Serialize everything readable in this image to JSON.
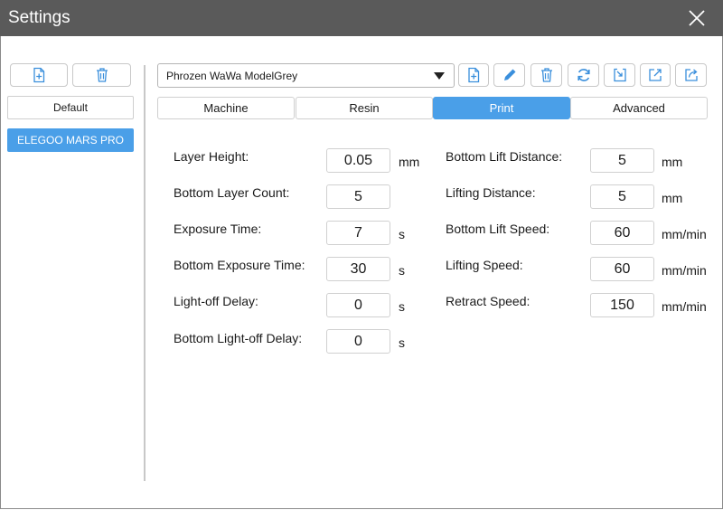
{
  "window": {
    "title": "Settings"
  },
  "sidebar": {
    "items": [
      {
        "label": "Default"
      },
      {
        "label": "ELEGOO MARS PRO"
      }
    ]
  },
  "profile": {
    "selected": "Phrozen WaWa ModelGrey"
  },
  "tabs": [
    {
      "label": "Machine"
    },
    {
      "label": "Resin"
    },
    {
      "label": "Print",
      "active": true
    },
    {
      "label": "Advanced"
    }
  ],
  "left_fields": [
    {
      "label": "Layer Height:",
      "value": "0.05",
      "unit": "mm"
    },
    {
      "label": "Bottom Layer Count:",
      "value": "5",
      "unit": ""
    },
    {
      "label": "Exposure Time:",
      "value": "7",
      "unit": "s"
    },
    {
      "label": "Bottom Exposure Time:",
      "value": "30",
      "unit": "s"
    },
    {
      "label": "Light-off Delay:",
      "value": "0",
      "unit": "s"
    },
    {
      "label": "Bottom Light-off Delay:",
      "value": "0",
      "unit": "s"
    }
  ],
  "right_fields": [
    {
      "label": "Bottom Lift Distance:",
      "value": "5",
      "unit": "mm"
    },
    {
      "label": "Lifting Distance:",
      "value": "5",
      "unit": "mm"
    },
    {
      "label": "Bottom Lift Speed:",
      "value": "60",
      "unit": "mm/min"
    },
    {
      "label": "Lifting Speed:",
      "value": "60",
      "unit": "mm/min"
    },
    {
      "label": "Retract Speed:",
      "value": "150",
      "unit": "mm/min"
    }
  ],
  "colors": {
    "accent": "#4a9fe8",
    "titlebar": "#5a5a5a"
  }
}
